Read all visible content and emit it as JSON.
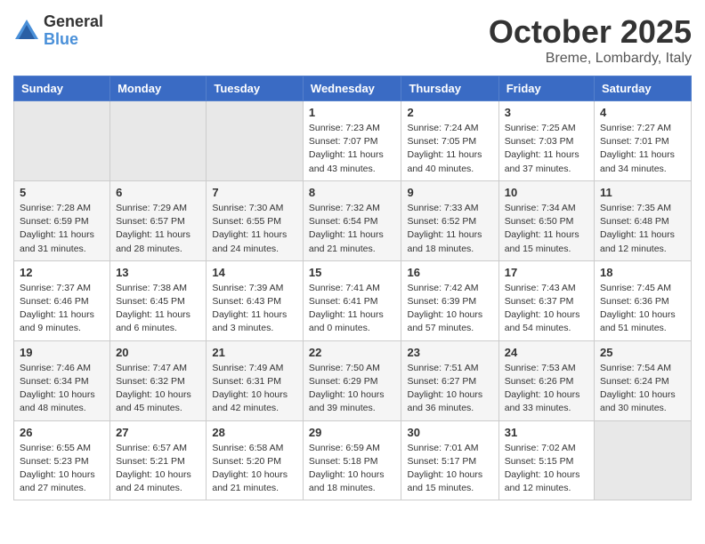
{
  "header": {
    "logo_general": "General",
    "logo_blue": "Blue",
    "month_title": "October 2025",
    "subtitle": "Breme, Lombardy, Italy"
  },
  "weekdays": [
    "Sunday",
    "Monday",
    "Tuesday",
    "Wednesday",
    "Thursday",
    "Friday",
    "Saturday"
  ],
  "weeks": [
    [
      {
        "day": "",
        "info": ""
      },
      {
        "day": "",
        "info": ""
      },
      {
        "day": "",
        "info": ""
      },
      {
        "day": "1",
        "info": "Sunrise: 7:23 AM\nSunset: 7:07 PM\nDaylight: 11 hours\nand 43 minutes."
      },
      {
        "day": "2",
        "info": "Sunrise: 7:24 AM\nSunset: 7:05 PM\nDaylight: 11 hours\nand 40 minutes."
      },
      {
        "day": "3",
        "info": "Sunrise: 7:25 AM\nSunset: 7:03 PM\nDaylight: 11 hours\nand 37 minutes."
      },
      {
        "day": "4",
        "info": "Sunrise: 7:27 AM\nSunset: 7:01 PM\nDaylight: 11 hours\nand 34 minutes."
      }
    ],
    [
      {
        "day": "5",
        "info": "Sunrise: 7:28 AM\nSunset: 6:59 PM\nDaylight: 11 hours\nand 31 minutes."
      },
      {
        "day": "6",
        "info": "Sunrise: 7:29 AM\nSunset: 6:57 PM\nDaylight: 11 hours\nand 28 minutes."
      },
      {
        "day": "7",
        "info": "Sunrise: 7:30 AM\nSunset: 6:55 PM\nDaylight: 11 hours\nand 24 minutes."
      },
      {
        "day": "8",
        "info": "Sunrise: 7:32 AM\nSunset: 6:54 PM\nDaylight: 11 hours\nand 21 minutes."
      },
      {
        "day": "9",
        "info": "Sunrise: 7:33 AM\nSunset: 6:52 PM\nDaylight: 11 hours\nand 18 minutes."
      },
      {
        "day": "10",
        "info": "Sunrise: 7:34 AM\nSunset: 6:50 PM\nDaylight: 11 hours\nand 15 minutes."
      },
      {
        "day": "11",
        "info": "Sunrise: 7:35 AM\nSunset: 6:48 PM\nDaylight: 11 hours\nand 12 minutes."
      }
    ],
    [
      {
        "day": "12",
        "info": "Sunrise: 7:37 AM\nSunset: 6:46 PM\nDaylight: 11 hours\nand 9 minutes."
      },
      {
        "day": "13",
        "info": "Sunrise: 7:38 AM\nSunset: 6:45 PM\nDaylight: 11 hours\nand 6 minutes."
      },
      {
        "day": "14",
        "info": "Sunrise: 7:39 AM\nSunset: 6:43 PM\nDaylight: 11 hours\nand 3 minutes."
      },
      {
        "day": "15",
        "info": "Sunrise: 7:41 AM\nSunset: 6:41 PM\nDaylight: 11 hours\nand 0 minutes."
      },
      {
        "day": "16",
        "info": "Sunrise: 7:42 AM\nSunset: 6:39 PM\nDaylight: 10 hours\nand 57 minutes."
      },
      {
        "day": "17",
        "info": "Sunrise: 7:43 AM\nSunset: 6:37 PM\nDaylight: 10 hours\nand 54 minutes."
      },
      {
        "day": "18",
        "info": "Sunrise: 7:45 AM\nSunset: 6:36 PM\nDaylight: 10 hours\nand 51 minutes."
      }
    ],
    [
      {
        "day": "19",
        "info": "Sunrise: 7:46 AM\nSunset: 6:34 PM\nDaylight: 10 hours\nand 48 minutes."
      },
      {
        "day": "20",
        "info": "Sunrise: 7:47 AM\nSunset: 6:32 PM\nDaylight: 10 hours\nand 45 minutes."
      },
      {
        "day": "21",
        "info": "Sunrise: 7:49 AM\nSunset: 6:31 PM\nDaylight: 10 hours\nand 42 minutes."
      },
      {
        "day": "22",
        "info": "Sunrise: 7:50 AM\nSunset: 6:29 PM\nDaylight: 10 hours\nand 39 minutes."
      },
      {
        "day": "23",
        "info": "Sunrise: 7:51 AM\nSunset: 6:27 PM\nDaylight: 10 hours\nand 36 minutes."
      },
      {
        "day": "24",
        "info": "Sunrise: 7:53 AM\nSunset: 6:26 PM\nDaylight: 10 hours\nand 33 minutes."
      },
      {
        "day": "25",
        "info": "Sunrise: 7:54 AM\nSunset: 6:24 PM\nDaylight: 10 hours\nand 30 minutes."
      }
    ],
    [
      {
        "day": "26",
        "info": "Sunrise: 6:55 AM\nSunset: 5:23 PM\nDaylight: 10 hours\nand 27 minutes."
      },
      {
        "day": "27",
        "info": "Sunrise: 6:57 AM\nSunset: 5:21 PM\nDaylight: 10 hours\nand 24 minutes."
      },
      {
        "day": "28",
        "info": "Sunrise: 6:58 AM\nSunset: 5:20 PM\nDaylight: 10 hours\nand 21 minutes."
      },
      {
        "day": "29",
        "info": "Sunrise: 6:59 AM\nSunset: 5:18 PM\nDaylight: 10 hours\nand 18 minutes."
      },
      {
        "day": "30",
        "info": "Sunrise: 7:01 AM\nSunset: 5:17 PM\nDaylight: 10 hours\nand 15 minutes."
      },
      {
        "day": "31",
        "info": "Sunrise: 7:02 AM\nSunset: 5:15 PM\nDaylight: 10 hours\nand 12 minutes."
      },
      {
        "day": "",
        "info": ""
      }
    ]
  ]
}
